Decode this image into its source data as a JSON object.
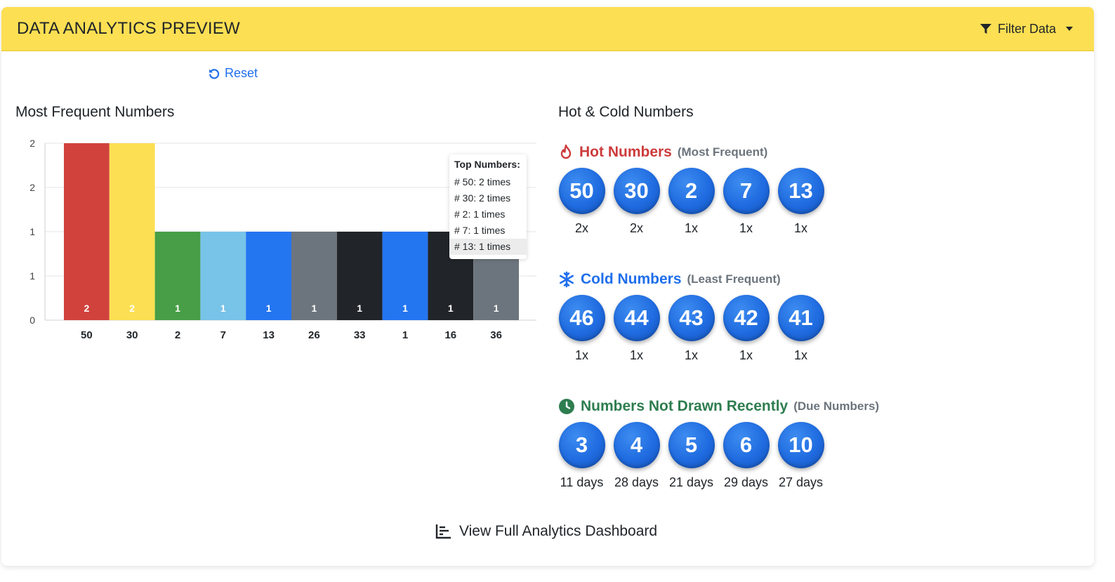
{
  "header": {
    "title": "DATA ANALYTICS PREVIEW",
    "filter_label": "Filter Data"
  },
  "reset_label": "Reset",
  "chart_section_title": "Most Frequent Numbers",
  "hot_cold_title": "Hot & Cold Numbers",
  "colors": {
    "header_bg": "#fcdf53",
    "link": "#1f6feb",
    "hot": "#cd3b3b",
    "cold": "#1f6feb",
    "due": "#2e7d4f"
  },
  "chart_data": {
    "type": "bar",
    "categories": [
      "50",
      "30",
      "2",
      "7",
      "13",
      "26",
      "33",
      "1",
      "16",
      "36"
    ],
    "values": [
      2,
      2,
      1,
      1,
      1,
      1,
      1,
      1,
      1,
      1
    ],
    "bar_colors": [
      "#d1423d",
      "#fcdf53",
      "#479e46",
      "#78c3e8",
      "#2475f0",
      "#6c757d",
      "#212529",
      "#2475f0",
      "#212529",
      "#6c757d"
    ],
    "y_tick_labels": [
      "0",
      "1",
      "1",
      "2",
      "2"
    ],
    "ylim": [
      0,
      2
    ],
    "grid": true,
    "legend": "none",
    "title": "Most Frequent Numbers",
    "xlabel": "",
    "ylabel": ""
  },
  "tooltip": {
    "title": "Top Numbers:",
    "rows": [
      "# 50: 2 times",
      "# 30: 2 times",
      "# 2: 1 times",
      "# 7: 1 times",
      "# 13: 1 times"
    ]
  },
  "hot": {
    "title": "Hot Numbers",
    "subtitle": "(Most Frequent)",
    "icon": "fire-icon",
    "balls": [
      {
        "number": "50",
        "caption": "2x"
      },
      {
        "number": "30",
        "caption": "2x"
      },
      {
        "number": "2",
        "caption": "1x"
      },
      {
        "number": "7",
        "caption": "1x"
      },
      {
        "number": "13",
        "caption": "1x"
      }
    ]
  },
  "cold": {
    "title": "Cold Numbers",
    "subtitle": "(Least Frequent)",
    "icon": "snowflake-icon",
    "balls": [
      {
        "number": "46",
        "caption": "1x"
      },
      {
        "number": "44",
        "caption": "1x"
      },
      {
        "number": "43",
        "caption": "1x"
      },
      {
        "number": "42",
        "caption": "1x"
      },
      {
        "number": "41",
        "caption": "1x"
      }
    ]
  },
  "due": {
    "title": "Numbers Not Drawn Recently",
    "subtitle": "(Due Numbers)",
    "icon": "clock-icon",
    "balls": [
      {
        "number": "3",
        "caption": "11 days"
      },
      {
        "number": "4",
        "caption": "28 days"
      },
      {
        "number": "5",
        "caption": "21 days"
      },
      {
        "number": "6",
        "caption": "29 days"
      },
      {
        "number": "10",
        "caption": "27 days"
      }
    ]
  },
  "footer_link": "View Full Analytics Dashboard"
}
